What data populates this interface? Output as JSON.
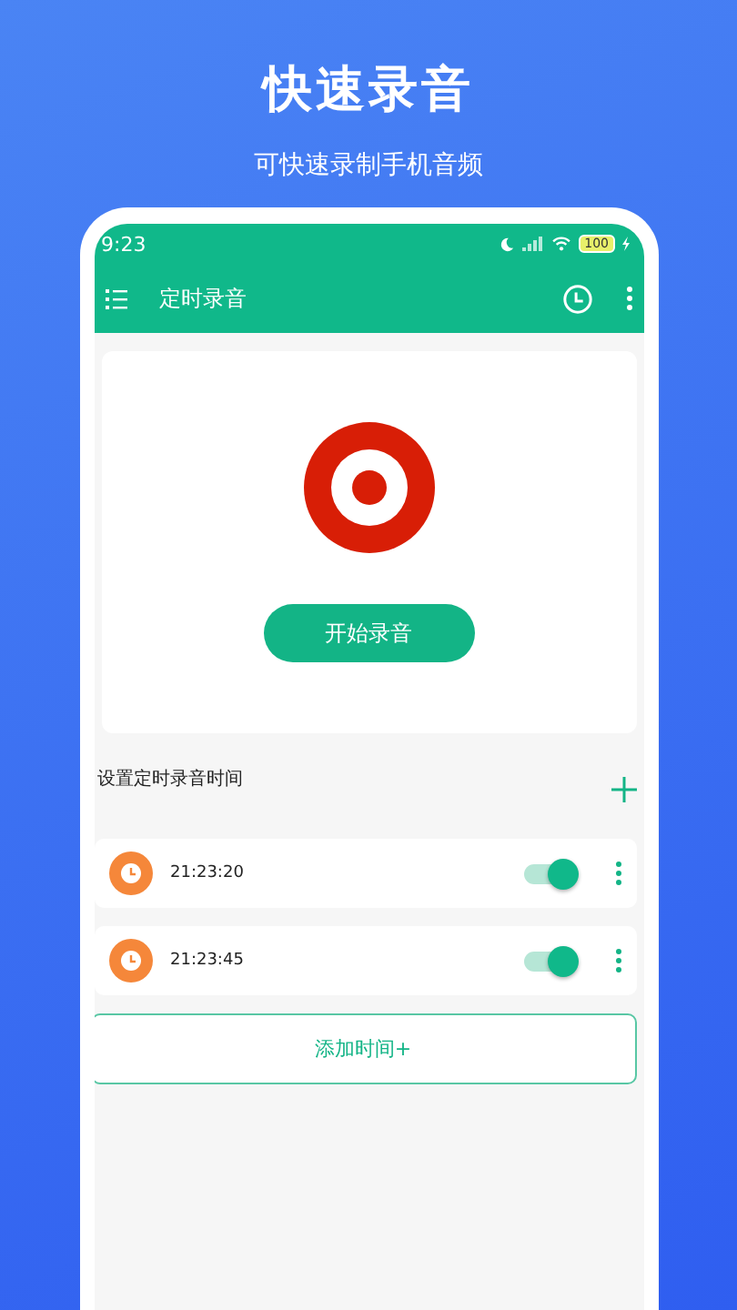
{
  "headline": "快速录音",
  "subtitle": "可快速录制手机音频",
  "status_bar": {
    "time": "9:23",
    "battery": "100"
  },
  "toolbar": {
    "title": "定时录音"
  },
  "recorder": {
    "button": "开始录音"
  },
  "schedule": {
    "title": "设置定时录音时间",
    "items": [
      {
        "time": "21:23:20",
        "on": true
      },
      {
        "time": "21:23:45",
        "on": true
      }
    ],
    "add_button": "添加时间+"
  }
}
